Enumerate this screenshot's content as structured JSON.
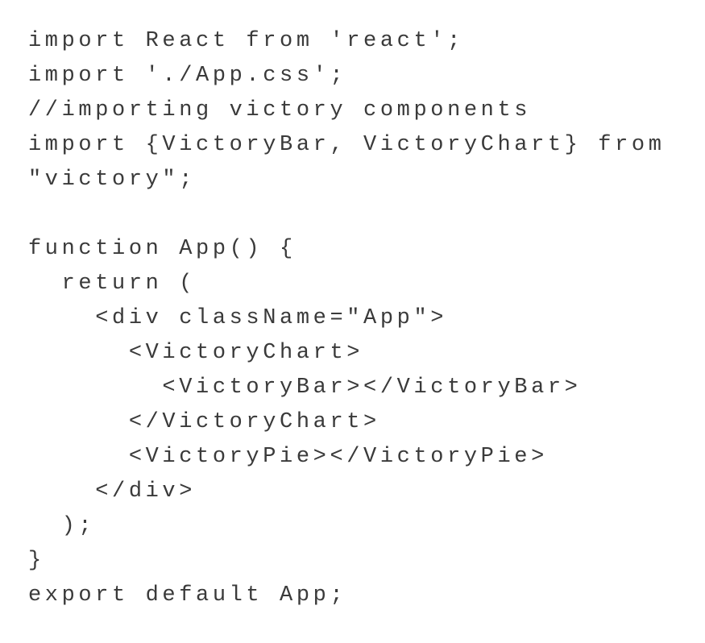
{
  "code": {
    "language": "jsx",
    "lines": [
      "import React from 'react';",
      "import './App.css';",
      "//importing victory components",
      "import {VictoryBar, VictoryChart} from",
      "\"victory\";",
      "",
      "function App() {",
      "  return (",
      "    <div className=\"App\">",
      "      <VictoryChart>",
      "        <VictoryBar></VictoryBar>",
      "      </VictoryChart>",
      "      <VictoryPie></VictoryPie>",
      "    </div>",
      "  );",
      "}",
      "export default App;"
    ]
  },
  "colors": {
    "text": "#3a3a3a",
    "background": "#ffffff"
  }
}
